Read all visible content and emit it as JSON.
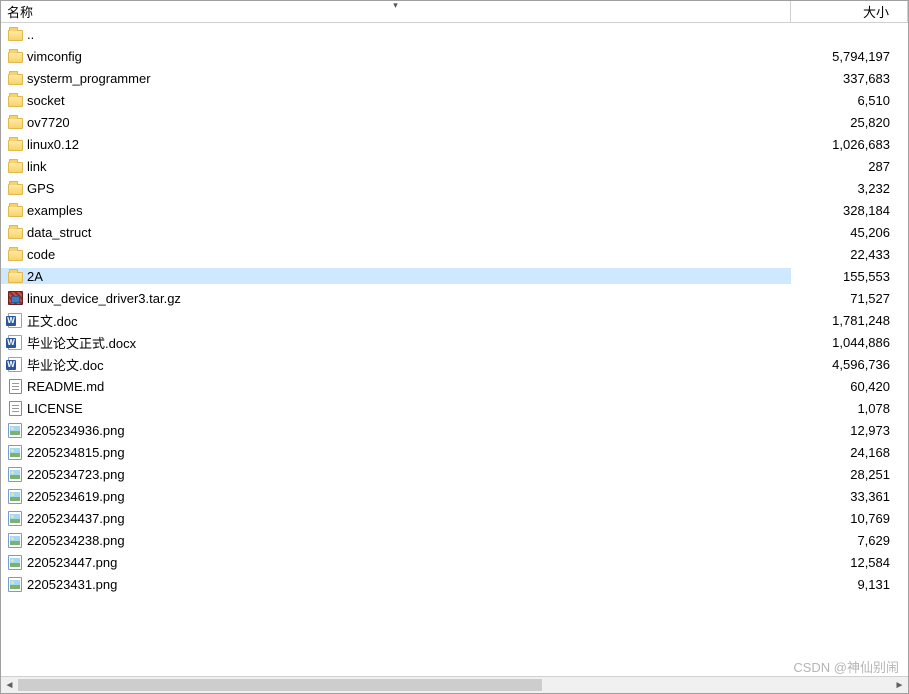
{
  "columns": {
    "name": "名称",
    "size": "大小"
  },
  "sort_indicator": "▾",
  "rows": [
    {
      "icon": "folder",
      "name": "..",
      "size": "",
      "selected": false
    },
    {
      "icon": "folder",
      "name": "vimconfig",
      "size": "5,794,197",
      "selected": false
    },
    {
      "icon": "folder",
      "name": "systerm_programmer",
      "size": "337,683",
      "selected": false
    },
    {
      "icon": "folder",
      "name": "socket",
      "size": "6,510",
      "selected": false
    },
    {
      "icon": "folder",
      "name": "ov7720",
      "size": "25,820",
      "selected": false
    },
    {
      "icon": "folder",
      "name": "linux0.12",
      "size": "1,026,683",
      "selected": false
    },
    {
      "icon": "folder",
      "name": "link",
      "size": "287",
      "selected": false
    },
    {
      "icon": "folder",
      "name": "GPS",
      "size": "3,232",
      "selected": false
    },
    {
      "icon": "folder",
      "name": "examples",
      "size": "328,184",
      "selected": false
    },
    {
      "icon": "folder",
      "name": "data_struct",
      "size": "45,206",
      "selected": false
    },
    {
      "icon": "folder",
      "name": "code",
      "size": "22,433",
      "selected": false
    },
    {
      "icon": "folder",
      "name": "2A",
      "size": "155,553",
      "selected": true
    },
    {
      "icon": "archive",
      "name": "linux_device_driver3.tar.gz",
      "size": "71,527",
      "selected": false
    },
    {
      "icon": "doc",
      "name": "正文.doc",
      "size": "1,781,248",
      "selected": false
    },
    {
      "icon": "doc",
      "name": "毕业论文正式.docx",
      "size": "1,044,886",
      "selected": false
    },
    {
      "icon": "doc",
      "name": "毕业论文.doc",
      "size": "4,596,736",
      "selected": false
    },
    {
      "icon": "file",
      "name": "README.md",
      "size": "60,420",
      "selected": false
    },
    {
      "icon": "file",
      "name": "LICENSE",
      "size": "1,078",
      "selected": false
    },
    {
      "icon": "png",
      "name": "2205234936.png",
      "size": "12,973",
      "selected": false
    },
    {
      "icon": "png",
      "name": "2205234815.png",
      "size": "24,168",
      "selected": false
    },
    {
      "icon": "png",
      "name": "2205234723.png",
      "size": "28,251",
      "selected": false
    },
    {
      "icon": "png",
      "name": "2205234619.png",
      "size": "33,361",
      "selected": false
    },
    {
      "icon": "png",
      "name": "2205234437.png",
      "size": "10,769",
      "selected": false
    },
    {
      "icon": "png",
      "name": "2205234238.png",
      "size": "7,629",
      "selected": false
    },
    {
      "icon": "png",
      "name": "220523447.png",
      "size": "12,584",
      "selected": false
    },
    {
      "icon": "png",
      "name": "220523431.png",
      "size": "9,131",
      "selected": false
    }
  ],
  "watermark": "CSDN @神仙别闹"
}
